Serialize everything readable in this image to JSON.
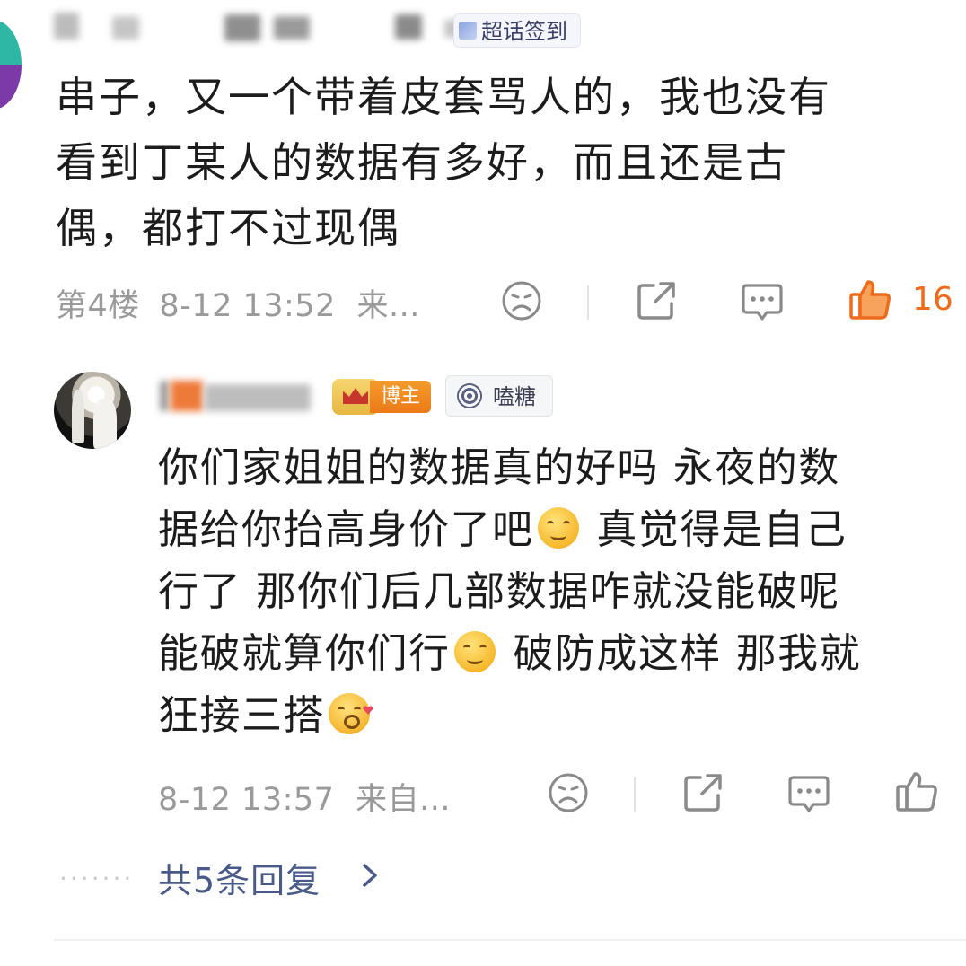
{
  "comment": {
    "badge_label": "超话签到",
    "lines": [
      "串子，又一个带着皮套骂人的，我也没有",
      "看到丁某人的数据有多好，而且还是古",
      "偶，都打不过现偶"
    ],
    "floor": "第4楼",
    "time": "8-12 13:52",
    "source": "来...",
    "like_count": "16",
    "like_color": "#ef6b1c"
  },
  "reply": {
    "badge_blogger": "博主",
    "badge_candy": "嗑糖",
    "lines": [
      {
        "text": "你们家姐姐的数据真的好吗 永夜的数"
      },
      {
        "text": "据给你抬高身价了吧",
        "emoji": "smile-emoji",
        "after": " 真觉得是自己"
      },
      {
        "text": "行了 那你们后几部数据咋就没能破呢"
      },
      {
        "text": "能破就算你们行",
        "emoji": "smile-emoji",
        "after": " 破防成这样 那我就"
      },
      {
        "text": "狂接三搭",
        "emoji": "pleading-emoji",
        "after": ""
      }
    ],
    "time": "8-12 13:57",
    "source": "来自...",
    "more_replies": "共5条回复"
  },
  "colors": {
    "meta": "#9a9a9a",
    "link": "#4a5a88",
    "accent_orange": "#ef6b1c"
  }
}
